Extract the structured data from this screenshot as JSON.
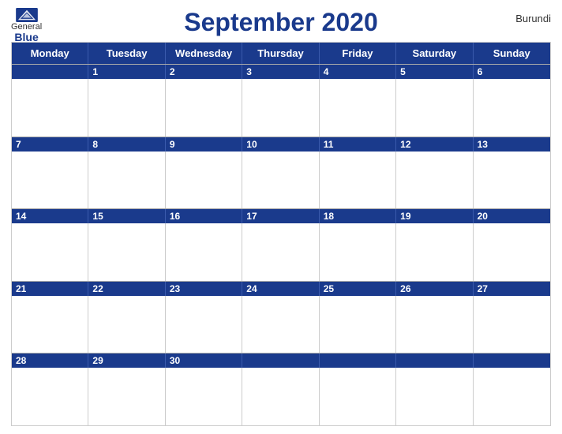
{
  "header": {
    "title": "September 2020",
    "country": "Burundi",
    "logo": {
      "general": "General",
      "blue": "Blue"
    }
  },
  "days": [
    "Monday",
    "Tuesday",
    "Wednesday",
    "Thursday",
    "Friday",
    "Saturday",
    "Sunday"
  ],
  "weeks": [
    [
      "",
      "1",
      "2",
      "3",
      "4",
      "5",
      "6"
    ],
    [
      "7",
      "8",
      "9",
      "10",
      "11",
      "12",
      "13"
    ],
    [
      "14",
      "15",
      "16",
      "17",
      "18",
      "19",
      "20"
    ],
    [
      "21",
      "22",
      "23",
      "24",
      "25",
      "26",
      "27"
    ],
    [
      "28",
      "29",
      "30",
      "",
      "",
      "",
      ""
    ]
  ]
}
